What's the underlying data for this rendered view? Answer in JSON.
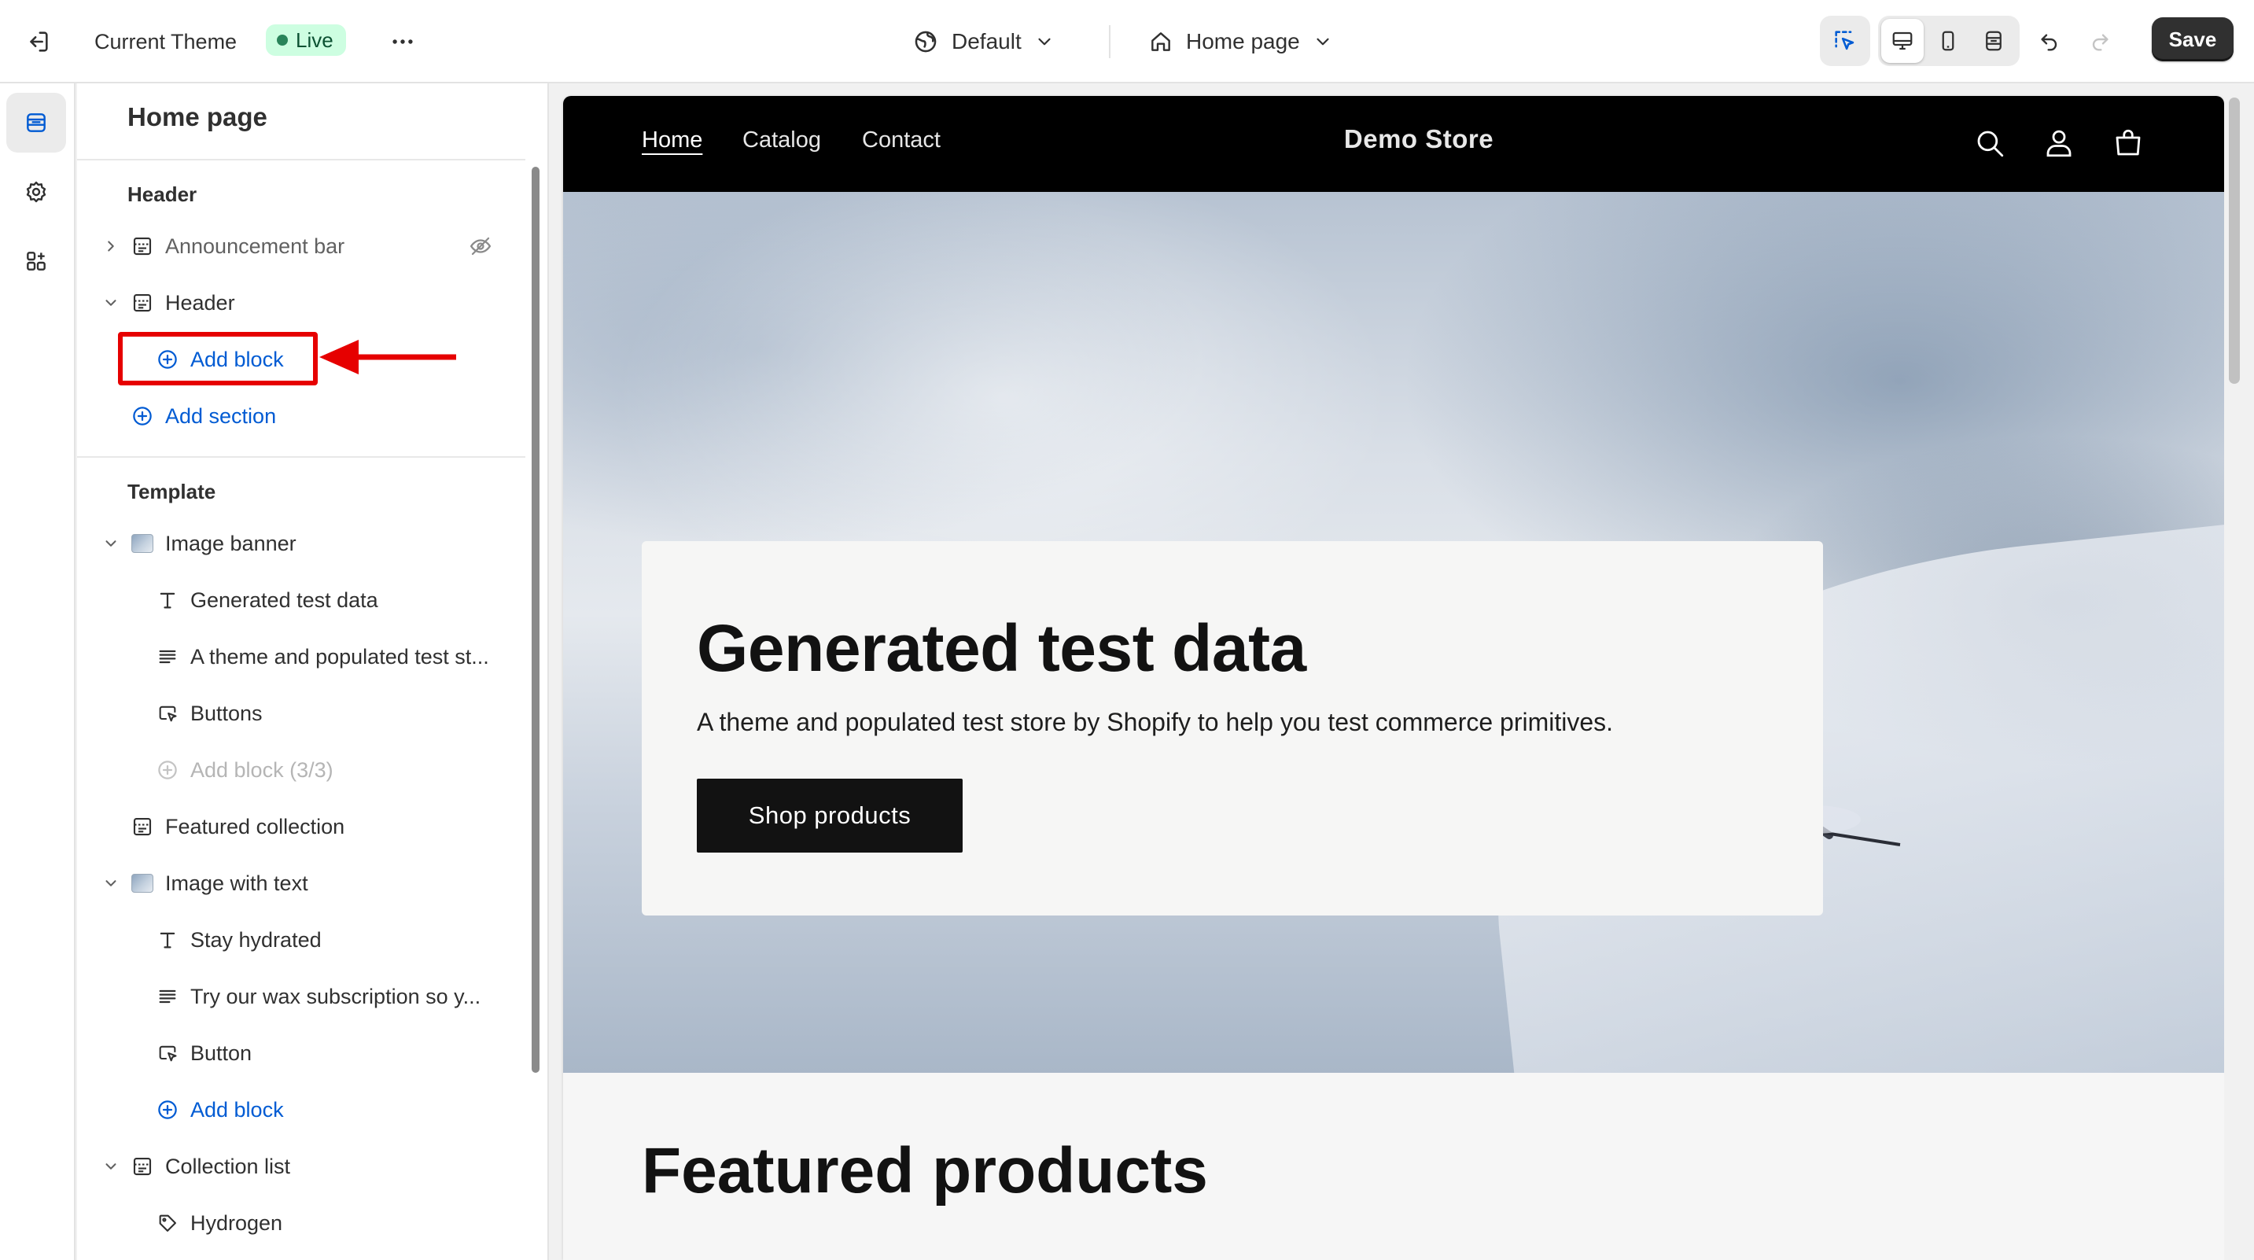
{
  "topbar": {
    "theme_name": "Current Theme",
    "live_badge": "Live",
    "preset_label": "Default",
    "page_label": "Home page",
    "save_label": "Save"
  },
  "sidebar": {
    "title": "Home page",
    "header_group": "Header",
    "header_rows": [
      {
        "label": "Announcement bar",
        "icon": "section-icon",
        "collapsed": true,
        "hidden": true
      },
      {
        "label": "Header",
        "icon": "section-icon",
        "collapsed": false
      }
    ],
    "header_add_block": "Add block",
    "header_add_section": "Add section",
    "template_group": "Template",
    "template_rows": [
      {
        "label": "Image banner",
        "level": 1,
        "icon": "image-thumb"
      },
      {
        "label": "Generated test data",
        "level": 2,
        "icon": "text-icon"
      },
      {
        "label": "A theme and populated test st...",
        "level": 2,
        "icon": "paragraph-icon"
      },
      {
        "label": "Buttons",
        "level": 2,
        "icon": "button-icon"
      },
      {
        "label": "Add block (3/3)",
        "level": 2,
        "icon": "add-circle-icon",
        "disabled": true
      },
      {
        "label": "Featured collection",
        "level": 1,
        "icon": "section-icon"
      },
      {
        "label": "Image with text",
        "level": 1,
        "icon": "image-thumb"
      },
      {
        "label": "Stay hydrated",
        "level": 2,
        "icon": "text-icon"
      },
      {
        "label": "Try our wax subscription so y...",
        "level": 2,
        "icon": "paragraph-icon"
      },
      {
        "label": "Button",
        "level": 2,
        "icon": "button-icon"
      },
      {
        "label": "Add block",
        "level": 2,
        "icon": "add-circle-icon",
        "add": true
      },
      {
        "label": "Collection list",
        "level": 1,
        "icon": "section-icon"
      },
      {
        "label": "Hydrogen",
        "level": 2,
        "icon": "tag-icon"
      }
    ]
  },
  "preview": {
    "nav": [
      "Home",
      "Catalog",
      "Contact"
    ],
    "store_name": "Demo Store",
    "hero_title": "Generated test data",
    "hero_subtitle": "A theme and populated test store by Shopify to help you test commerce primitives.",
    "hero_cta": "Shop products",
    "featured_title": "Featured products"
  },
  "colors": {
    "accent_blue": "#005bd3",
    "annotation_red": "#e60000",
    "live_badge_bg": "#cdfee1",
    "save_button_bg": "#303030"
  }
}
